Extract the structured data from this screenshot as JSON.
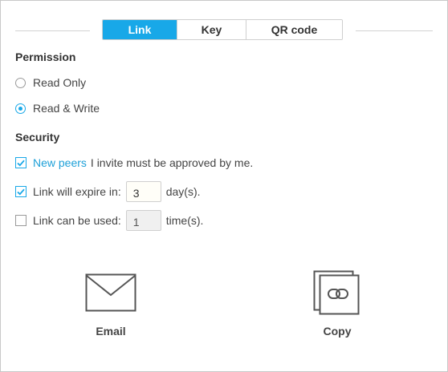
{
  "tabs": [
    {
      "label": "Link",
      "active": true
    },
    {
      "label": "Key",
      "active": false
    },
    {
      "label": "QR code",
      "active": false
    }
  ],
  "permission": {
    "title": "Permission",
    "options": [
      {
        "label": "Read Only",
        "checked": false
      },
      {
        "label": "Read & Write",
        "checked": true
      }
    ]
  },
  "security": {
    "title": "Security",
    "approve": {
      "checked": true,
      "link_text": "New peers",
      "text": "I invite must be approved by me."
    },
    "expire": {
      "checked": true,
      "label": "Link will expire in:",
      "value": "3",
      "unit": "day(s)."
    },
    "usage": {
      "checked": false,
      "label": "Link can be used:",
      "value": "1",
      "unit": "time(s)."
    }
  },
  "actions": {
    "email": {
      "label": "Email",
      "icon": "envelope-icon"
    },
    "copy": {
      "label": "Copy",
      "icon": "copy-link-icon"
    }
  },
  "colors": {
    "accent": "#18a8e8",
    "link": "#1ea0d8"
  }
}
